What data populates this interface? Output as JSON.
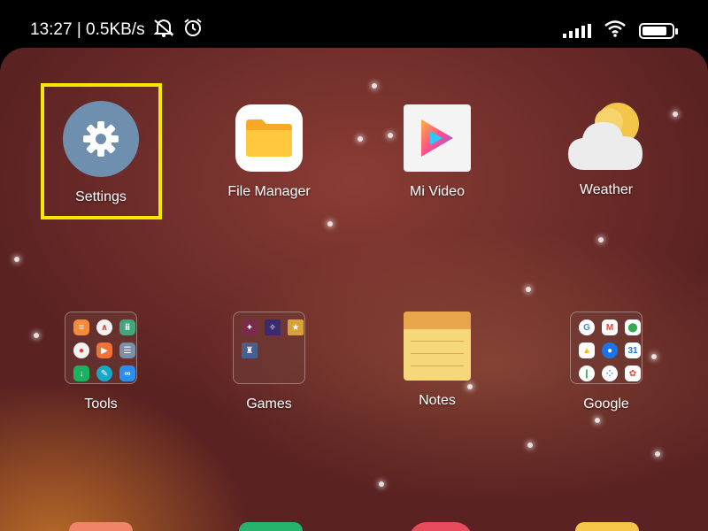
{
  "status_bar": {
    "time_speed": "13:27 | 0.5KB/s",
    "icons": [
      "notifications-off-icon",
      "alarm-icon",
      "signal-icon",
      "wifi-icon",
      "battery-icon"
    ],
    "battery_level": 0.85
  },
  "home": {
    "row1": [
      {
        "label": "Settings",
        "icon": "gear-icon"
      },
      {
        "label": "File Manager",
        "icon": "folder-icon"
      },
      {
        "label": "Mi Video",
        "icon": "play-icon"
      },
      {
        "label": "Weather",
        "icon": "weather-icon"
      }
    ],
    "row2": [
      {
        "label": "Tools",
        "icon": "tools-folder-icon"
      },
      {
        "label": "Games",
        "icon": "games-folder-icon"
      },
      {
        "label": "Notes",
        "icon": "notes-icon"
      },
      {
        "label": "Google",
        "icon": "google-folder-icon"
      }
    ]
  },
  "colors": {
    "highlight": "#f5e800",
    "settings_icon_bg": "#6f8fae"
  }
}
